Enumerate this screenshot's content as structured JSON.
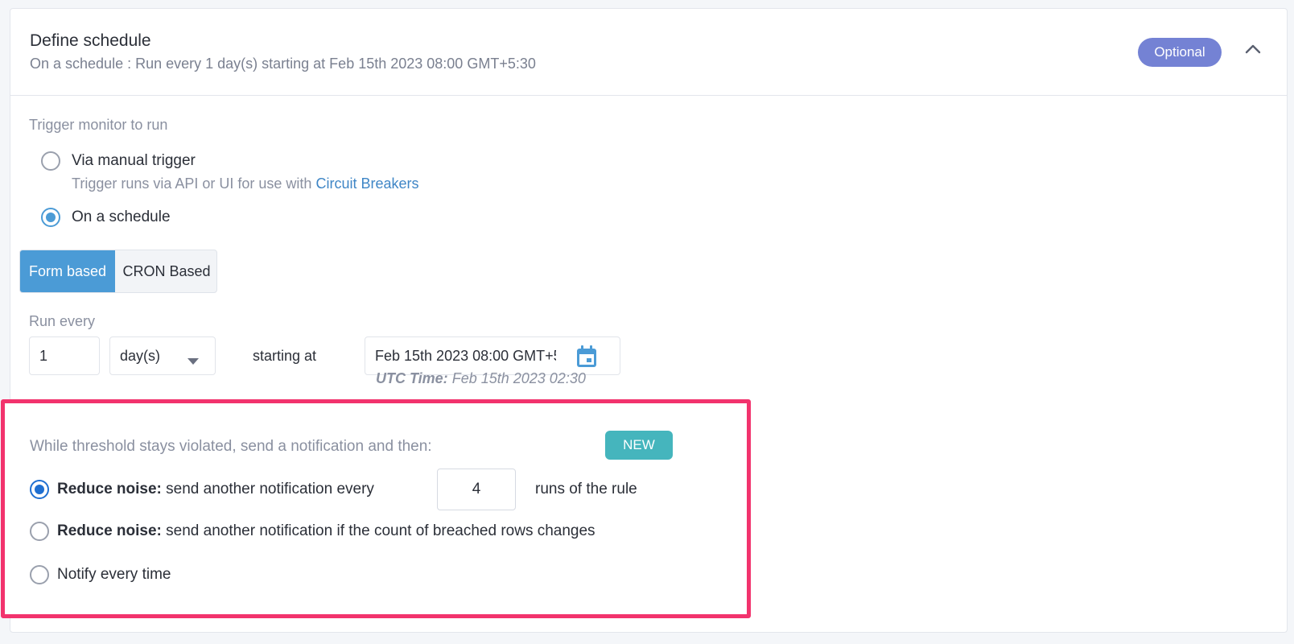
{
  "header": {
    "title": "Define schedule",
    "subtitle": "On a schedule : Run every 1 day(s) starting at Feb 15th 2023 08:00 GMT+5:30",
    "badge": "Optional"
  },
  "trigger": {
    "label": "Trigger monitor to run",
    "options": [
      {
        "label": "Via manual trigger",
        "description_prefix": "Trigger runs via API or UI for use with ",
        "description_link": "Circuit Breakers",
        "selected": false
      },
      {
        "label": "On a schedule",
        "selected": true
      }
    ]
  },
  "schedule_mode": {
    "tabs": [
      "Form based",
      "CRON Based"
    ],
    "active": "Form based"
  },
  "run_every": {
    "label": "Run every",
    "value": "1",
    "unit": "day(s)",
    "starting_label": "starting at",
    "start_value": "Feb 15th 2023 08:00 GMT+5:30",
    "utc_label": "UTC Time:",
    "utc_value": "Feb 15th 2023 02:30"
  },
  "notification": {
    "heading": "While threshold stays violated, send a notification and then:",
    "new_badge": "NEW",
    "options": [
      {
        "bold": "Reduce noise:",
        "text": "send another notification every",
        "input_value": "4",
        "suffix": "runs of the rule",
        "selected": true
      },
      {
        "bold": "Reduce noise:",
        "text": "send another notification if the count of breached rows changes",
        "selected": false
      },
      {
        "text": "Notify every time",
        "selected": false
      }
    ]
  },
  "colors": {
    "accent": "#4b9bd6",
    "optional_badge": "#7482d4",
    "new_badge": "#45b5bd",
    "highlight_border": "#f2336d",
    "link": "#3f86c6"
  }
}
